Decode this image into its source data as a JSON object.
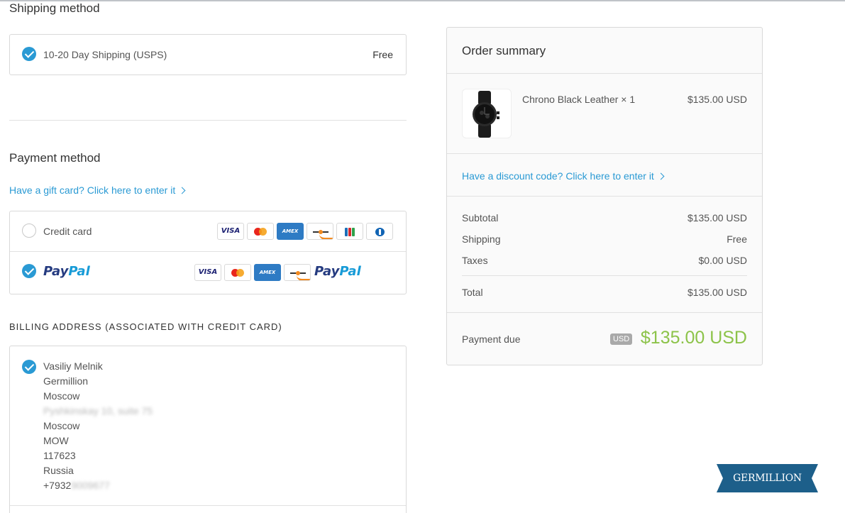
{
  "shipping": {
    "heading": "Shipping method",
    "option_label": "10-20 Day Shipping (USPS)",
    "option_price": "Free"
  },
  "payment": {
    "heading": "Payment method",
    "gift_link": "Have a gift card? Click here to enter it",
    "credit_card_label": "Credit card",
    "credit_cards": [
      "VISA",
      "Mastercard",
      "AMEX",
      "Discover",
      "JCB",
      "Diners Club"
    ],
    "paypal_logo_text": [
      "Pay",
      "Pal"
    ],
    "paypal_cards": [
      "VISA",
      "Mastercard",
      "AMEX",
      "Discover"
    ]
  },
  "billing": {
    "heading": "BILLING ADDRESS (ASSOCIATED WITH CREDIT CARD)",
    "lines": [
      "Vasiliy Melnik",
      "Germillion",
      "Moscow",
      "Pyshkinskay 10, suite 75",
      "Moscow",
      "MOW",
      "117623",
      "Russia"
    ],
    "phone_visible": "+7932",
    "phone_hidden": "9009677"
  },
  "order_summary": {
    "heading": "Order summary",
    "item": {
      "name": "Chrono Black Leather × 1",
      "price": "$135.00 USD",
      "image": "black-wristwatch"
    },
    "discount_link": "Have a discount code? Click here to enter it",
    "subtotal_label": "Subtotal",
    "subtotal_value": "$135.00 USD",
    "shipping_label": "Shipping",
    "shipping_value": "Free",
    "taxes_label": "Taxes",
    "taxes_value": "$0.00 USD",
    "total_label": "Total",
    "total_value": "$135.00 USD",
    "payment_due_label": "Payment due",
    "currency_badge": "USD",
    "payment_due_value": "$135.00 USD"
  },
  "brand": {
    "name": "GERMILLION",
    "color": "#1d5f8a"
  },
  "colors": {
    "accent": "#2a9ad4",
    "due_green": "#8cc349"
  }
}
